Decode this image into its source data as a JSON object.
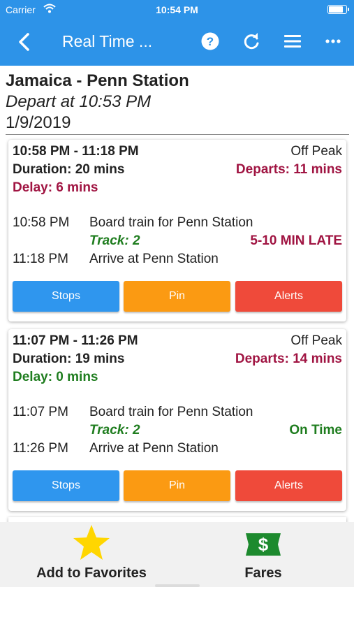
{
  "status_bar": {
    "carrier": "Carrier",
    "time": "10:54 PM",
    "battery_level": 0.85
  },
  "nav": {
    "title": "Real Time ..."
  },
  "header": {
    "route": "Jamaica - Penn Station",
    "depart": "Depart at 10:53 PM",
    "date": "1/9/2019"
  },
  "trips": [
    {
      "time_range": "10:58 PM - 11:18 PM",
      "fare_type": "Off Peak",
      "duration": "Duration: 20 mins",
      "departs": "Departs: 11 mins",
      "delay": "Delay: 6 mins",
      "board_time": "10:58 PM",
      "board_text": "Board train for Penn Station",
      "track": "Track: 2",
      "status": "5-10 MIN LATE",
      "arrive_time": "11:18 PM",
      "arrive_text": "Arrive at Penn Station",
      "buttons": {
        "stops": "Stops",
        "pin": "Pin",
        "alerts": "Alerts"
      }
    },
    {
      "time_range": "11:07 PM - 11:26 PM",
      "fare_type": "Off Peak",
      "duration": "Duration: 19 mins",
      "departs": "Departs: 14 mins",
      "delay": "Delay: 0 mins",
      "board_time": "11:07 PM",
      "board_text": "Board train for Penn Station",
      "track": "Track: 2",
      "status": "On Time",
      "arrive_time": "11:26 PM",
      "arrive_text": "Arrive at Penn Station",
      "buttons": {
        "stops": "Stops",
        "pin": "Pin",
        "alerts": "Alerts"
      }
    }
  ],
  "bottom_bar": {
    "favorites_label": "Add to Favorites",
    "fares_label": "Fares"
  },
  "colors": {
    "nav_blue": "#2d93e8",
    "late_red": "#a01442",
    "ontime_green": "#1f7d1f",
    "stops_blue": "#2f96ee",
    "pin_orange": "#fb9a12",
    "alerts_red": "#ef4a3a"
  },
  "icons": [
    "back-chevron-icon",
    "help-icon",
    "refresh-icon",
    "menu-icon",
    "more-icon",
    "star-icon",
    "dollar-bill-icon",
    "wifi-icon",
    "battery-icon"
  ]
}
